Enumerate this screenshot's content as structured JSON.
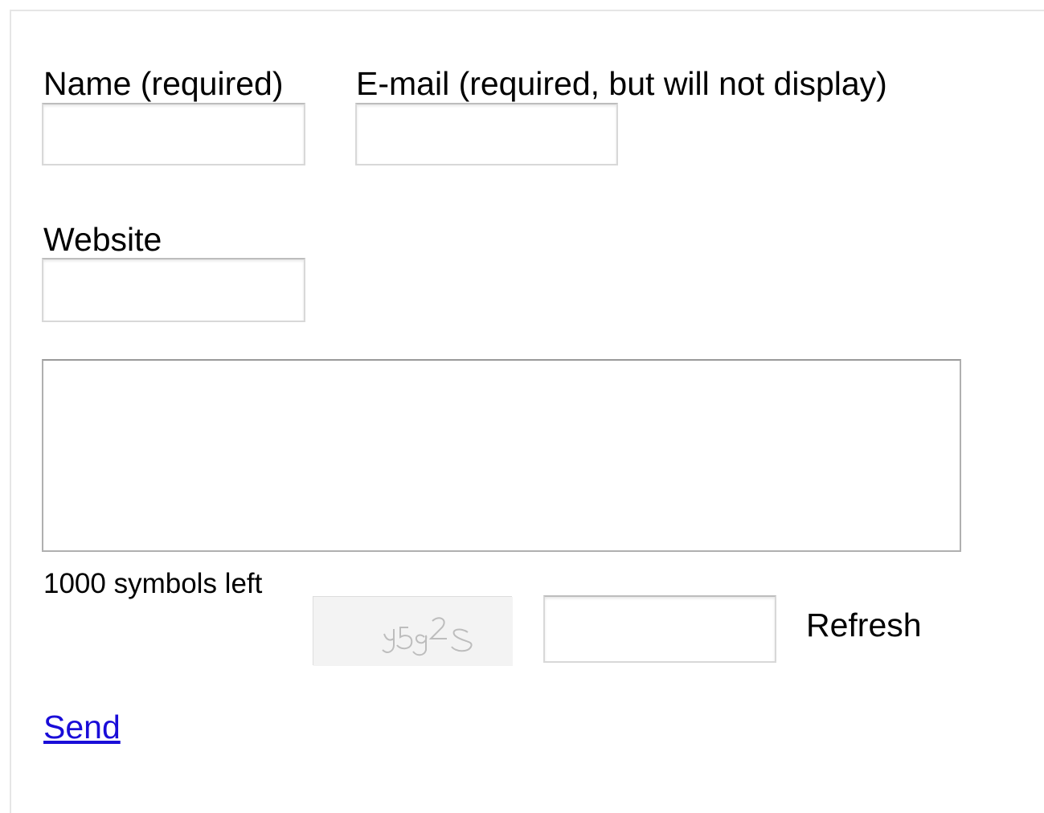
{
  "form": {
    "name_label": "Name (required)",
    "email_label": "E-mail (required, but will not display)",
    "website_label": "Website",
    "name_value": "",
    "email_value": "",
    "website_value": "",
    "message_value": "",
    "counter_text": "1000 symbols left",
    "captcha_text": "y5g2s",
    "captcha_value": "",
    "refresh_label": "Refresh",
    "send_label": "Send"
  },
  "colors": {
    "link": "#1a0dd8",
    "input_border": "#d8d8d8",
    "textarea_border": "#b0b0b0",
    "frame_border": "#e6e6e6"
  }
}
